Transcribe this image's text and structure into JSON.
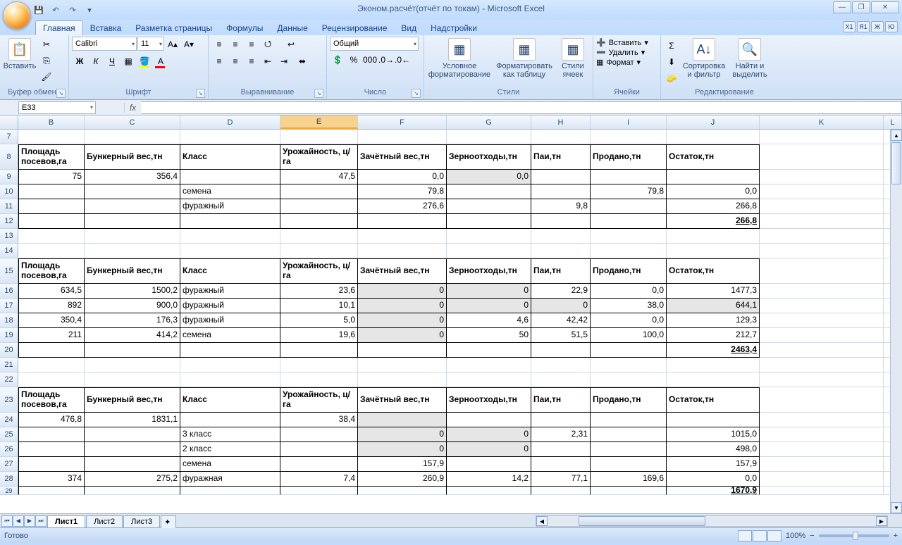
{
  "app": {
    "title": "Эконом.расчёт(отчёт по токам) - Microsoft Excel"
  },
  "tabs": {
    "t0": "Главная",
    "t1": "Вставка",
    "t2": "Разметка страницы",
    "t3": "Формулы",
    "t4": "Данные",
    "t5": "Рецензирование",
    "t6": "Вид",
    "t7": "Надстройки"
  },
  "ribbon": {
    "paste": "Вставить",
    "clipboard": "Буфер обмена",
    "font_name": "Calibri",
    "font_size": "11",
    "font": "Шрифт",
    "alignment": "Выравнивание",
    "number_format": "Общий",
    "number": "Число",
    "cond_fmt1": "Условное",
    "cond_fmt2": "форматирование",
    "fmt_table1": "Форматировать",
    "fmt_table2": "как таблицу",
    "cell_styles1": "Стили",
    "cell_styles2": "ячеек",
    "styles": "Стили",
    "insert": "Вставить",
    "delete": "Удалить",
    "format": "Формат",
    "cells": "Ячейки",
    "sort1": "Сортировка",
    "sort2": "и фильтр",
    "find1": "Найти и",
    "find2": "выделить",
    "editing": "Редактирование"
  },
  "namebox": "E33",
  "cols": {
    "B": "B",
    "C": "C",
    "D": "D",
    "E": "E",
    "F": "F",
    "G": "G",
    "H": "H",
    "I": "I",
    "J": "J",
    "K": "K",
    "L": "L"
  },
  "rownums": {
    "r7": "7",
    "r8": "8",
    "r9": "9",
    "r10": "10",
    "r11": "11",
    "r12": "12",
    "r13": "13",
    "r14": "14",
    "r15": "15",
    "r16": "16",
    "r17": "17",
    "r18": "18",
    "r19": "19",
    "r20": "20",
    "r21": "21",
    "r22": "22",
    "r23": "23",
    "r24": "24",
    "r25": "25",
    "r26": "26",
    "r27": "27",
    "r28": "28",
    "r29": "29"
  },
  "hdr": {
    "B": "Площадь посевов,га",
    "C": "Бункерный вес,тн",
    "D": "Класс",
    "E": "Урожайность, ц/га",
    "F": "Зачётный вес,тн",
    "G": "Зерноотходы,тн",
    "H": "Паи,тн",
    "I": "Продано,тн",
    "J": "Остаток,тн"
  },
  "t1": {
    "r9": {
      "B": "75",
      "C": "356,4",
      "E": "47,5",
      "F": "0,0",
      "G": "0,0"
    },
    "r10": {
      "D": "семена",
      "F": "79,8",
      "I": "79,8",
      "J": "0,0"
    },
    "r11": {
      "D": "фуражный",
      "F": "276,6",
      "H": "9,8",
      "J": "266,8"
    },
    "r12": {
      "J": "266,8"
    }
  },
  "t2": {
    "r16": {
      "B": "634,5",
      "C": "1500,2",
      "D": "фуражный",
      "E": "23,6",
      "F": "0",
      "G": "0",
      "H": "22,9",
      "I": "0,0",
      "J": "1477,3"
    },
    "r17": {
      "B": "892",
      "C": "900,0",
      "D": "фуражный",
      "E": "10,1",
      "F": "0",
      "G": "0",
      "H": "0",
      "I": "38,0",
      "J": "644,1"
    },
    "r18": {
      "B": "350,4",
      "C": "176,3",
      "D": "фуражный",
      "E": "5,0",
      "F": "0",
      "G": "4,6",
      "H": "42,42",
      "I": "0,0",
      "J": "129,3"
    },
    "r19": {
      "B": "211",
      "C": "414,2",
      "D": "семена",
      "E": "19,6",
      "F": "0",
      "G": "50",
      "H": "51,5",
      "I": "100,0",
      "J": "212,7"
    },
    "r20": {
      "J": "2463,4"
    }
  },
  "t3": {
    "r24": {
      "B": "476,8",
      "C": "1831,1",
      "E": "38,4"
    },
    "r25": {
      "D": "3 класс",
      "F": "0",
      "G": "0",
      "H": "2,31",
      "J": "1015,0"
    },
    "r26": {
      "D": "2 класс",
      "F": "0",
      "G": "0",
      "J": "498,0"
    },
    "r27": {
      "D": "семена",
      "F": "157,9",
      "J": "157,9"
    },
    "r28": {
      "B": "374",
      "C": "275,2",
      "D": "фуражная",
      "E": "7,4",
      "F": "260,9",
      "G": "14,2",
      "H": "77,1",
      "I": "169,6",
      "J": "0,0"
    },
    "r29": {
      "J": "1670,9"
    }
  },
  "sheets": {
    "s1": "Лист1",
    "s2": "Лист2",
    "s3": "Лист3"
  },
  "status": {
    "ready": "Готово",
    "zoom": "100%"
  }
}
